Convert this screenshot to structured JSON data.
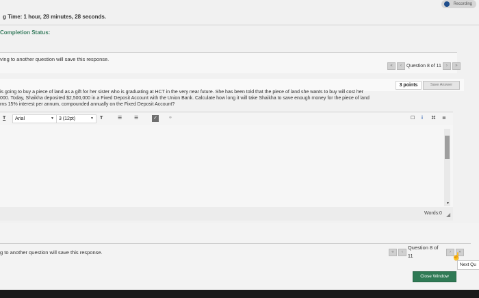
{
  "recording": {
    "label": "Recording",
    "accent": "#1f4e8c"
  },
  "timer": {
    "text": "g Time: 1 hour, 28 minutes, 28 seconds."
  },
  "completion": {
    "label": "Completion Status:",
    "color": "#3c7f62"
  },
  "warning_top": "ving to another question will save this response.",
  "nav_top": {
    "label": "Question 8 of 11",
    "prev_icon": "double-chevron-left",
    "next_icon": "double-chevron-right"
  },
  "question": {
    "points": "3 points",
    "save_label": "Save Answer",
    "lines": [
      "is going to buy a piece of land as a gift for her sister who is graduating at HCT in the very near future. She has been told that the piece of land she wants to buy will cost her",
      "000. Today, Shaikha deposited $2,500,000 in a Fixed Deposit Account with the Union Bank. Calculate how long it will take Shaikha to save enough money for the piece of land",
      "rns 15% interest per annum, compounded annually on the Fixed Deposit Account?"
    ]
  },
  "toolbar": {
    "font_icon": "T",
    "font_family": "Arial",
    "font_size": "3 (12pt)",
    "text_color_icon": "T",
    "bullet_icon": "☰",
    "numbered_icon": "☰",
    "right_icons": [
      "☐",
      "i",
      "⌘",
      "≣"
    ]
  },
  "editor": {
    "words_label": "Words:0"
  },
  "warning_bottom": "g to another question will save this response.",
  "nav_bottom": {
    "label": "Question 8 of 11"
  },
  "next_question_label": "Next Qu",
  "close_window_label": "Close Window",
  "colors": {
    "close_button": "#2f7a55",
    "completion": "#3c7f62"
  }
}
